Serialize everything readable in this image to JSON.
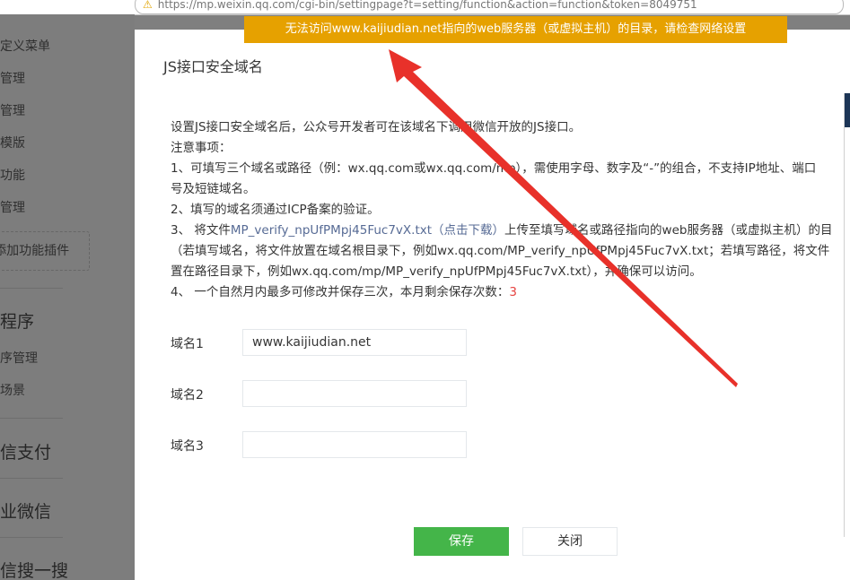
{
  "browser": {
    "url": "https://mp.weixin.qq.com/cgi-bin/settingpage?t=setting/function&action=function&token=8049751"
  },
  "sidebar": {
    "items": [
      {
        "label": "自定义菜单"
      },
      {
        "label": "留言管理"
      },
      {
        "label": "投票管理"
      },
      {
        "label": "页面模版"
      },
      {
        "label": "原创功能"
      },
      {
        "label": "赞赏管理"
      }
    ],
    "plugin_label": "+ 添加功能插件",
    "section_miniprogram": "小程序",
    "miniprogram_items": [
      {
        "label": "小程序管理"
      },
      {
        "label": "展示场景"
      }
    ],
    "section_pay": "微信支付",
    "section_work": "企业微信",
    "section_search": "微信搜一搜"
  },
  "banner": {
    "text": "无法访问www.kaijiudian.net指向的web服务器（或虚拟主机）的目录，请检查网络设置"
  },
  "dialog": {
    "title": "JS接口安全域名",
    "intro": "设置JS接口安全域名后，公众号开发者可在该域名下调用微信开放的JS接口。",
    "notes_title": "注意事项：",
    "note1_line1": "1、可填写三个域名或路径（例：wx.qq.com或wx.qq.com/mp），需使用字母、数字及“-”的组合，不支持IP地址、端口",
    "note1_line2": "号及短链域名。",
    "note2": "2、填写的域名须通过ICP备案的验证。",
    "note3_prefix": "3、 将文件",
    "note3_file": "MP_verify_npUfPMpj45Fuc7vX.txt",
    "note3_download": "（点击下载）",
    "note3_suffix": "上传至填写域名或路径指向的web服务器（或虚拟主机）的目",
    "note3_line2": "（若填写域名，将文件放置在域名根目录下，例如wx.qq.com/MP_verify_npUfPMpj45Fuc7vX.txt；若填写路径，将文件",
    "note3_line3": "置在路径目录下，例如wx.qq.com/mp/MP_verify_npUfPMpj45Fuc7vX.txt），并确保可以访问。",
    "note4_prefix": "4、 一个自然月内最多可修改并保存三次，本月剩余保存次数：",
    "note4_count": "3",
    "fields": [
      {
        "label": "域名1",
        "value": "www.kaijiudian.net"
      },
      {
        "label": "域名2",
        "value": ""
      },
      {
        "label": "域名3",
        "value": ""
      }
    ],
    "save_label": "保存",
    "close_label": "关闭"
  },
  "colors": {
    "banner_bg": "#e6a100",
    "primary_button": "#44b549",
    "link": "#576b95",
    "count_red": "#e64340",
    "annotation_arrow": "#e8312a"
  }
}
